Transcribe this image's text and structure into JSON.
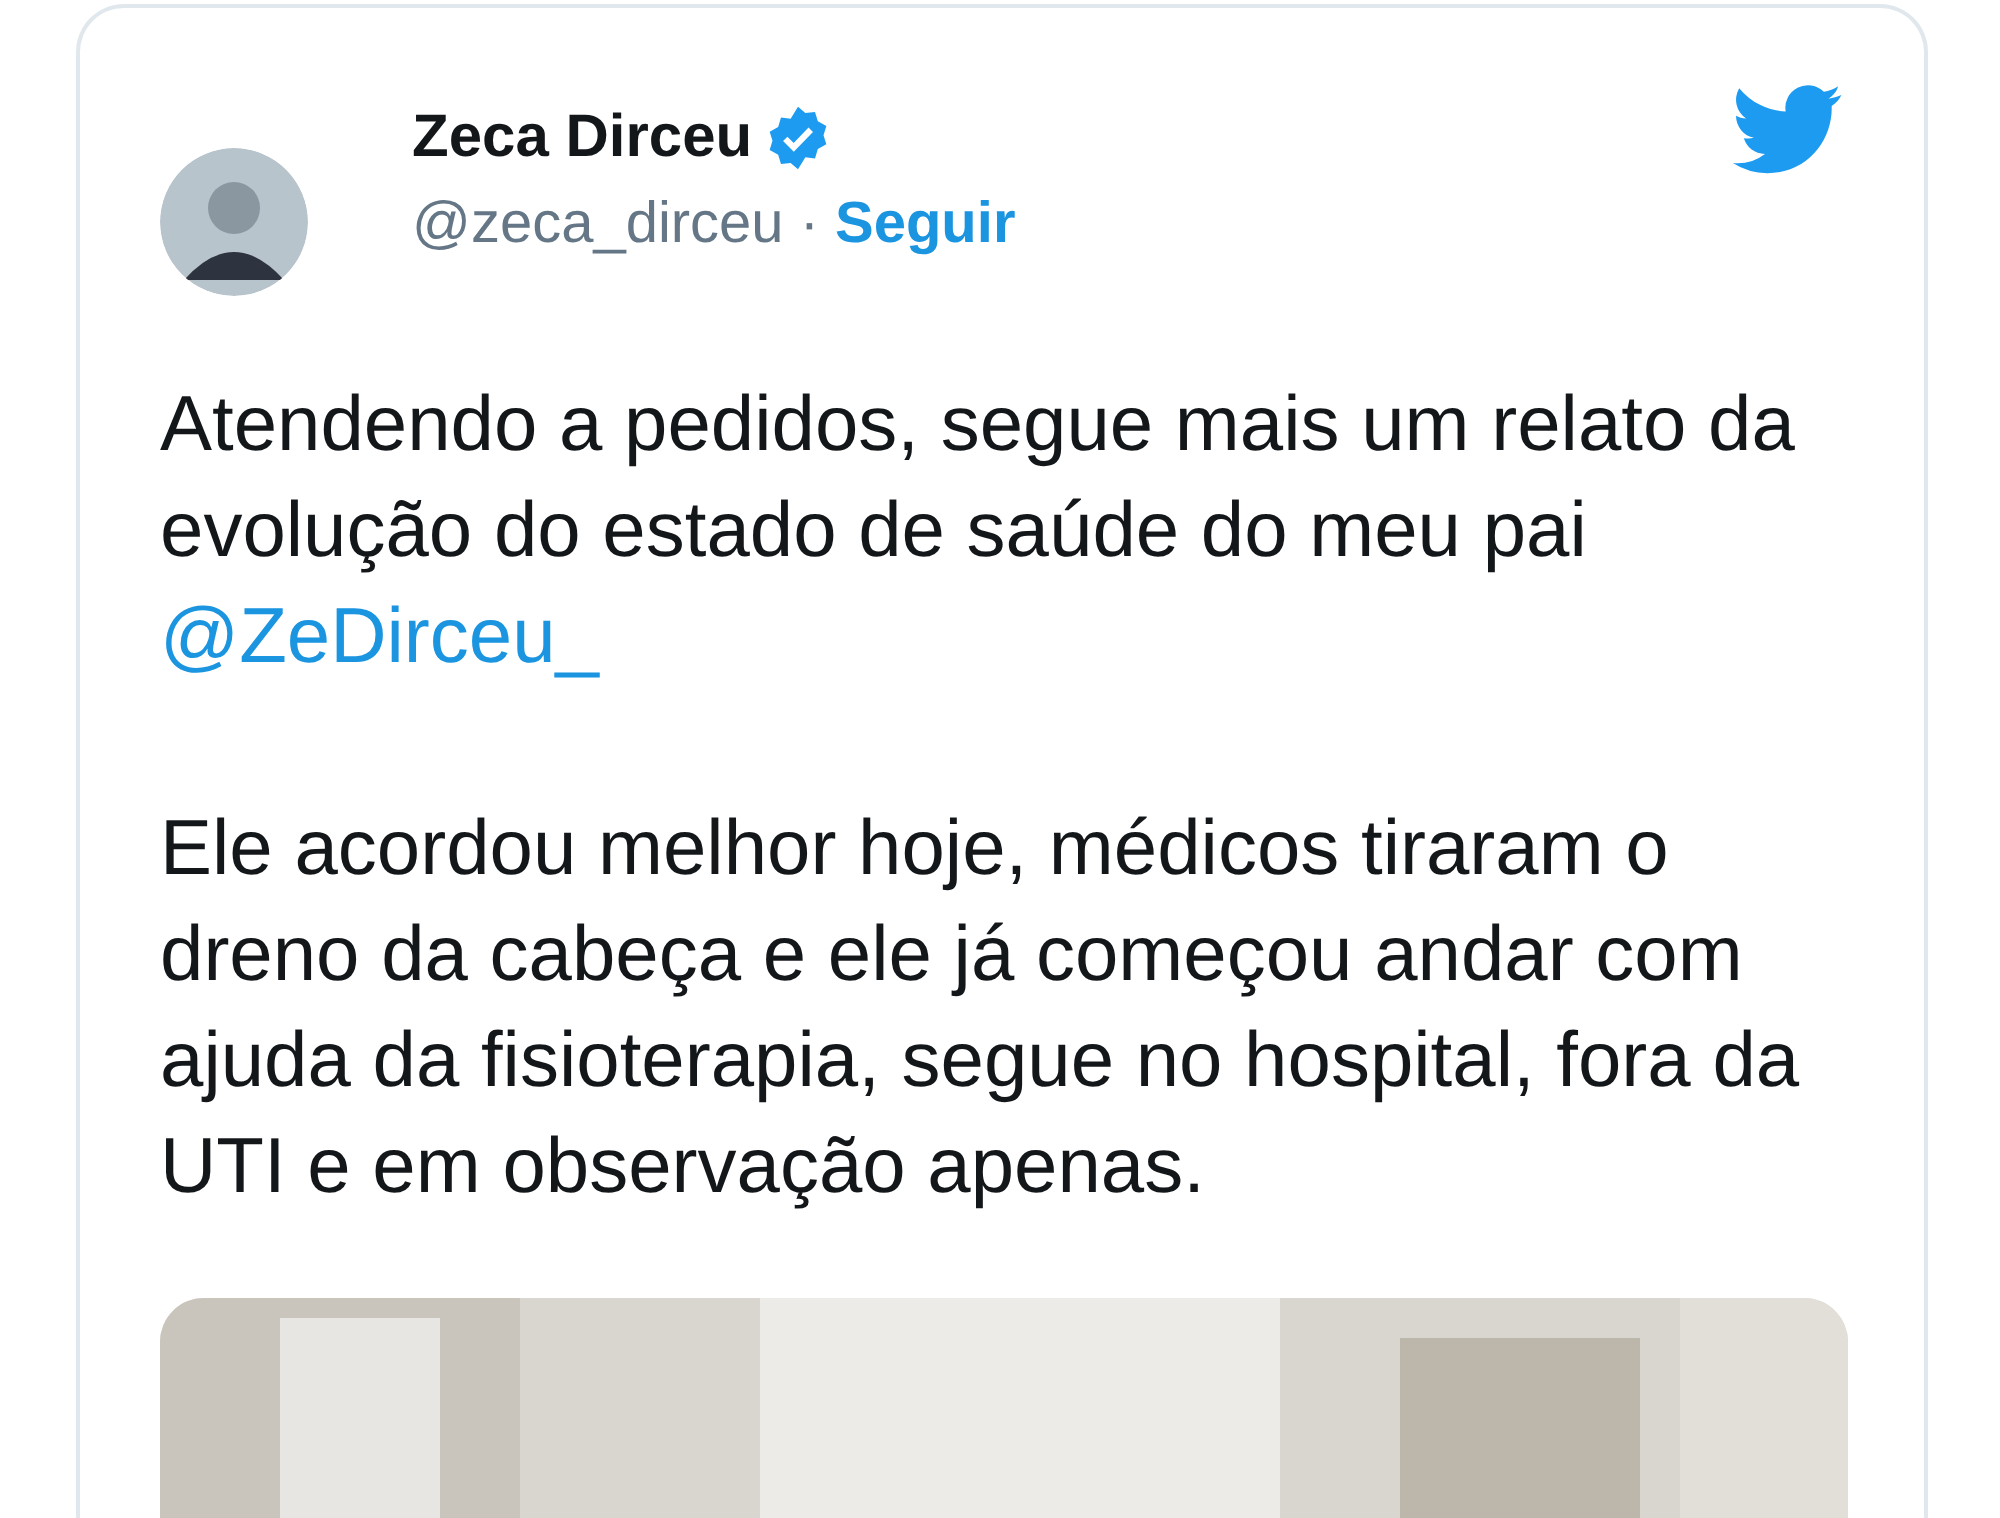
{
  "tweet": {
    "author": {
      "name": "Zeca Dirceu",
      "verified": true,
      "handle": "@zeca_dirceu",
      "separator": "·",
      "follow": "Seguir"
    },
    "paragraphs": [
      [
        {
          "kind": "text",
          "text": "Atendendo a pedidos, segue mais um relato da evolução do estado de saúde do meu pai "
        },
        {
          "kind": "mention",
          "text": "@ZeDirceu_"
        }
      ],
      [
        {
          "kind": "text",
          "text": "Ele acordou melhor hoje, médicos tiraram o dreno da cabeça e ele já começou andar com ajuda da fisioterapia, segue no hospital, fora da UTI e em observação apenas."
        }
      ]
    ],
    "media": {
      "kind": "picture"
    }
  }
}
